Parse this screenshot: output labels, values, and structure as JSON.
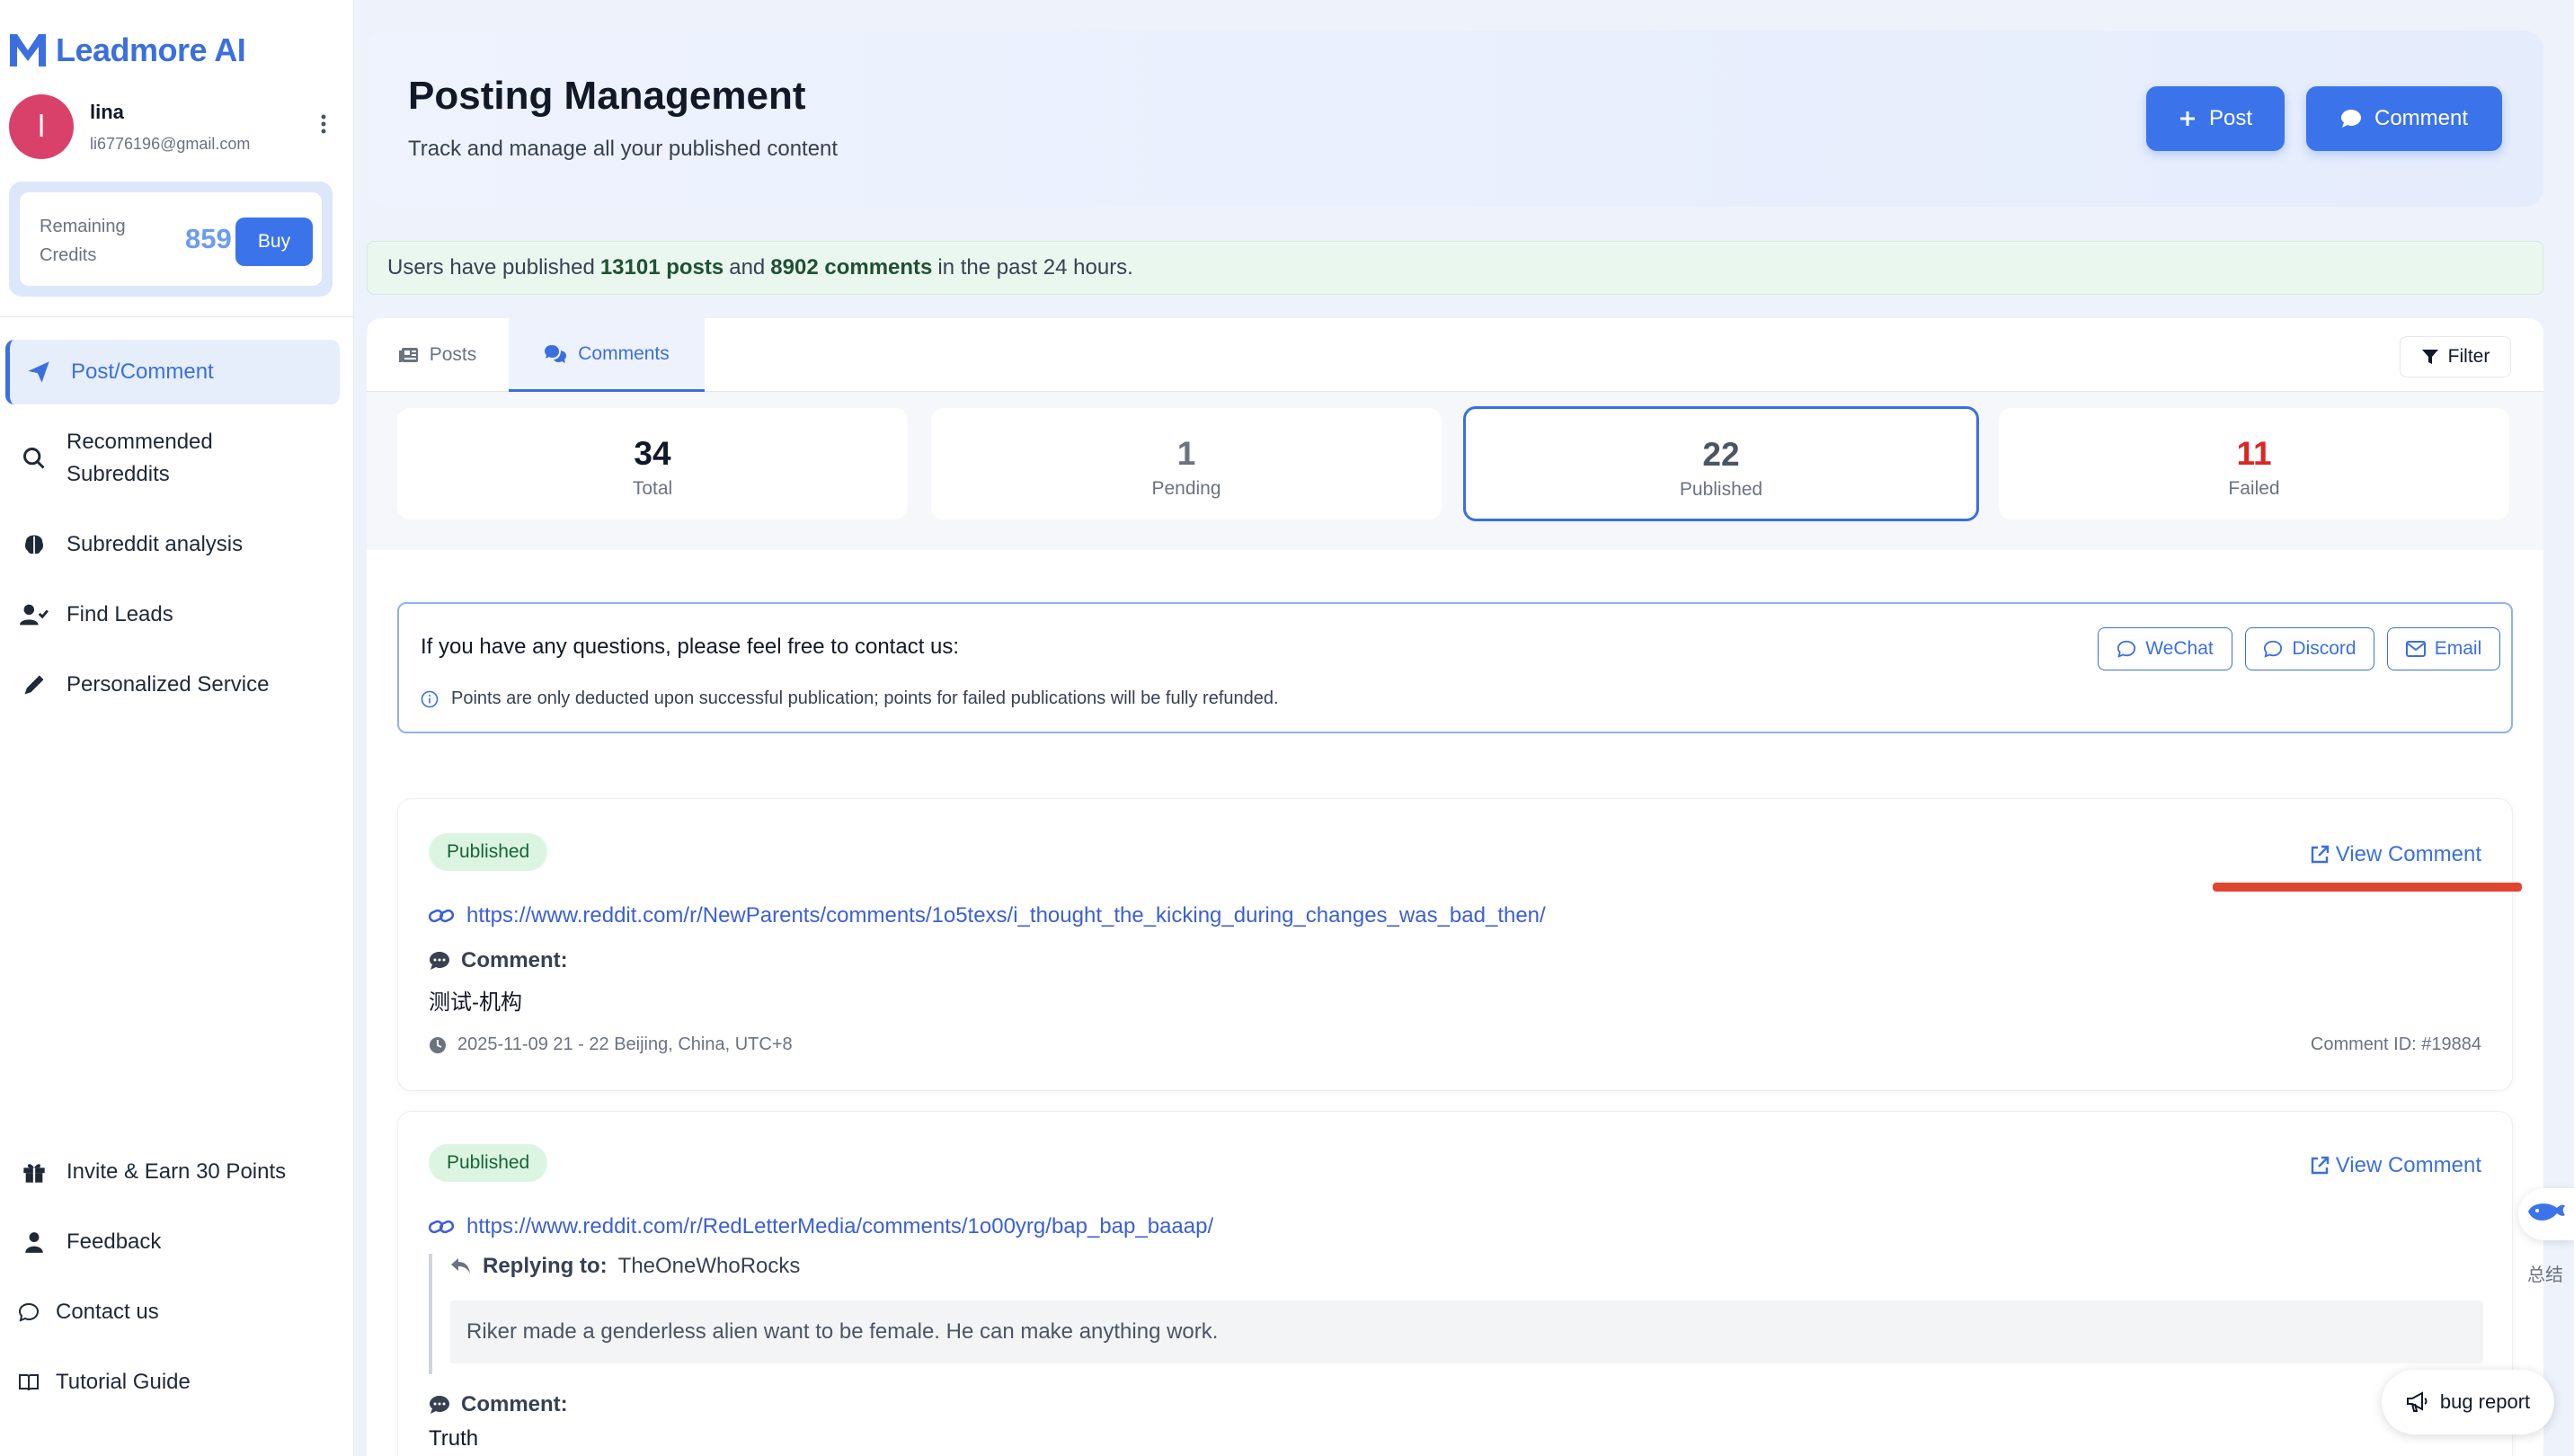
{
  "app": {
    "name": "Leadmore AI"
  },
  "user": {
    "initial": "l",
    "name": "lina",
    "email": "li6776196@gmail.com"
  },
  "credits": {
    "label": "Remaining Credits",
    "value": "859",
    "buy_label": "Buy"
  },
  "nav": {
    "items": [
      {
        "label": "Post/Comment",
        "icon": "paper-plane-icon",
        "active": true
      },
      {
        "label": "Recommended Subreddits",
        "icon": "search-icon"
      },
      {
        "label": "Subreddit analysis",
        "icon": "brain-icon"
      },
      {
        "label": "Find Leads",
        "icon": "user-check-icon"
      },
      {
        "label": "Personalized Service",
        "icon": "pen-icon"
      }
    ],
    "bottom": [
      {
        "label": "Invite & Earn 30 Points",
        "icon": "gift-icon"
      },
      {
        "label": "Feedback",
        "icon": "user-tie-icon"
      },
      {
        "label": "Contact us",
        "icon": "chat-bubble-icon"
      },
      {
        "label": "Tutorial Guide",
        "icon": "book-icon"
      }
    ]
  },
  "header": {
    "title": "Posting Management",
    "subtitle": "Track and manage all your published content",
    "post_label": "Post",
    "comment_label": "Comment"
  },
  "banner": {
    "prefix": "Users have published",
    "posts": "13101 posts",
    "mid": "and",
    "comments": "8902 comments",
    "suffix": "in the past 24 hours."
  },
  "tabs": [
    {
      "label": "Posts",
      "active": false
    },
    {
      "label": "Comments",
      "active": true
    }
  ],
  "filter_label": "Filter",
  "stats": [
    {
      "value": "34",
      "label": "Total",
      "color": "#111827"
    },
    {
      "value": "1",
      "label": "Pending",
      "color": "#6b7280"
    },
    {
      "value": "22",
      "label": "Published",
      "color": "#4b5563",
      "selected": true
    },
    {
      "value": "11",
      "label": "Failed",
      "color": "#dc2626"
    }
  ],
  "contact": {
    "title": "If you have any questions, please feel free to contact us:",
    "note": "Points are only deducted upon successful publication; points for failed publications will be fully refunded.",
    "buttons": [
      "WeChat",
      "Discord",
      "Email"
    ]
  },
  "cards": [
    {
      "status": "Published",
      "view_label": "View Comment",
      "url": "https://www.reddit.com/r/NewParents/comments/1o5texs/i_thought_the_kicking_during_changes_was_bad_then/",
      "comment_label": "Comment:",
      "comment": "测试-机构",
      "time": "2025-11-09 21 - 22 Beijing, China, UTC+8",
      "comment_id": "Comment ID: #19884"
    },
    {
      "status": "Published",
      "view_label": "View Comment",
      "url": "https://www.reddit.com/r/RedLetterMedia/comments/1o00yrg/bap_bap_baaap/",
      "replying_label": "Replying to:",
      "replying_to": "TheOneWhoRocks",
      "reply_text": "Riker made a genderless alien want to be female. He can make anything work.",
      "comment_label": "Comment:",
      "comment": "Truth"
    }
  ],
  "widgets": {
    "summary_label": "总结",
    "bug_label": "bug report"
  },
  "colors": {
    "accent": "#3b74ea",
    "published_bg": "#dcf5e3",
    "failed": "#dc2626",
    "annotation": "#e0452f"
  }
}
